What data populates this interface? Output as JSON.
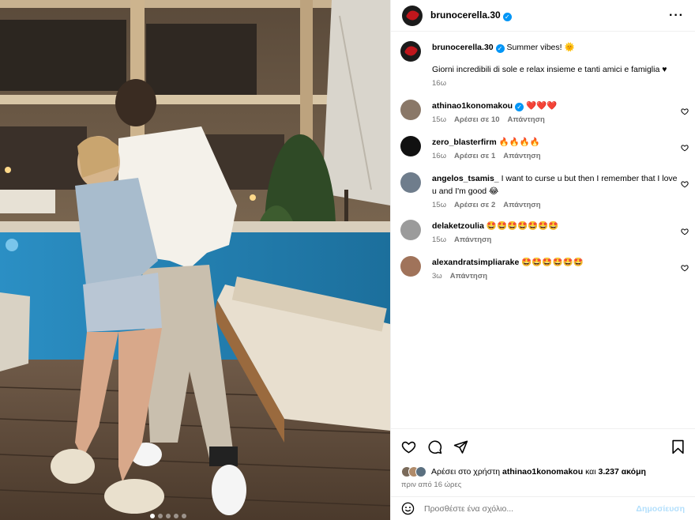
{
  "post": {
    "author": "brunocerella.30",
    "caption_title": "Summer vibes! 🌞",
    "caption_text": "Giorni incredibili di sole e relax insieme e tanti amici e famiglia ♥",
    "caption_time": "16ω"
  },
  "comments": [
    {
      "user": "athinao1konomakou",
      "text": "❤️❤️❤️",
      "time": "15ω",
      "likes": "Αρέσει σε 10",
      "reply": "Απάντηση",
      "verified": true,
      "avatar_color": "#8a7868"
    },
    {
      "user": "zero_blasterfirm",
      "text": "🔥🔥🔥🔥",
      "time": "16ω",
      "likes": "Αρέσει σε 1",
      "reply": "Απάντηση",
      "verified": false,
      "avatar_color": "#111111"
    },
    {
      "user": "angelos_tsamis_",
      "text": "I want to curse u but then I remember that I love u and I'm good 😂",
      "time": "15ω",
      "likes": "Αρέσει σε 2",
      "reply": "Απάντηση",
      "verified": false,
      "avatar_color": "#6f7d8c"
    },
    {
      "user": "delaketzoulia",
      "text": "🤩🤩🤩🤩🤩🤩🤩",
      "time": "15ω",
      "likes": "",
      "reply": "Απάντηση",
      "verified": false,
      "avatar_color": "#9b9b9b"
    },
    {
      "user": "alexandratsimpliarake",
      "text": "🤩🤩🤩🤩🤩🤩",
      "time": "3ω",
      "likes": "",
      "reply": "Απάντηση",
      "verified": false,
      "avatar_color": "#a0735a"
    }
  ],
  "likes": {
    "prefix": "Αρέσει στο χρήστη",
    "user": "athinao1konomakou",
    "middle": "και",
    "count": "3.237 ακόμη"
  },
  "posted_ago": "πριν από 16 ώρες",
  "add_comment": {
    "placeholder": "Προσθέστε ένα σχόλιο...",
    "post_label": "Δημοσίευση"
  },
  "colors": {
    "accent": "#0095f6",
    "heart_red": "#ed4956",
    "post_disabled": "#b2dffc",
    "muted_text": "#737373"
  }
}
